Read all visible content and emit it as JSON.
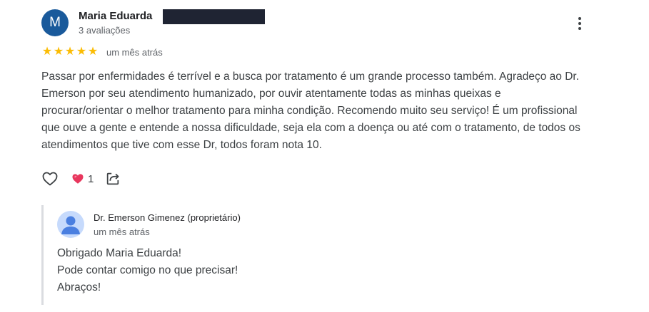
{
  "review": {
    "avatar_letter": "M",
    "reviewer_name": "Maria Eduarda",
    "reviewer_meta": "3 avaliações",
    "rating": 5,
    "stars": [
      "★",
      "★",
      "★",
      "★",
      "★"
    ],
    "date": "um mês atrás",
    "text": "Passar por enfermidades é terrível e a busca por tratamento é um grande processo também. Agradeço ao Dr. Emerson por seu atendimento humanizado, por ouvir atentamente todas as minhas queixas e procurar/orientar o melhor tratamento para minha condição. Recomendo muito seu serviço! É um profissional que ouve a gente e entende a nossa dificuldade, seja ela com a doença ou até com o tratamento, de todos os atendimentos que tive com esse Dr, todos foram nota 10.",
    "reaction_count": "1"
  },
  "owner_reply": {
    "name": "Dr. Emerson Gimenez (proprietário)",
    "date": "um mês atrás",
    "lines": [
      "Obrigado Maria Eduarda!",
      "Pode contar comigo no que precisar!",
      "Abraços!"
    ]
  },
  "colors": {
    "avatar": "#1a5a9b",
    "star": "#fbbc04",
    "heart_reaction": "#e8365d",
    "owner_avatar_bg": "#c6dafc",
    "owner_avatar_fg": "#4a7fe0"
  },
  "icons": {
    "more": "more-vert-icon",
    "like": "heart-outline-icon",
    "reaction": "heart-filled-icon",
    "share": "share-icon"
  }
}
